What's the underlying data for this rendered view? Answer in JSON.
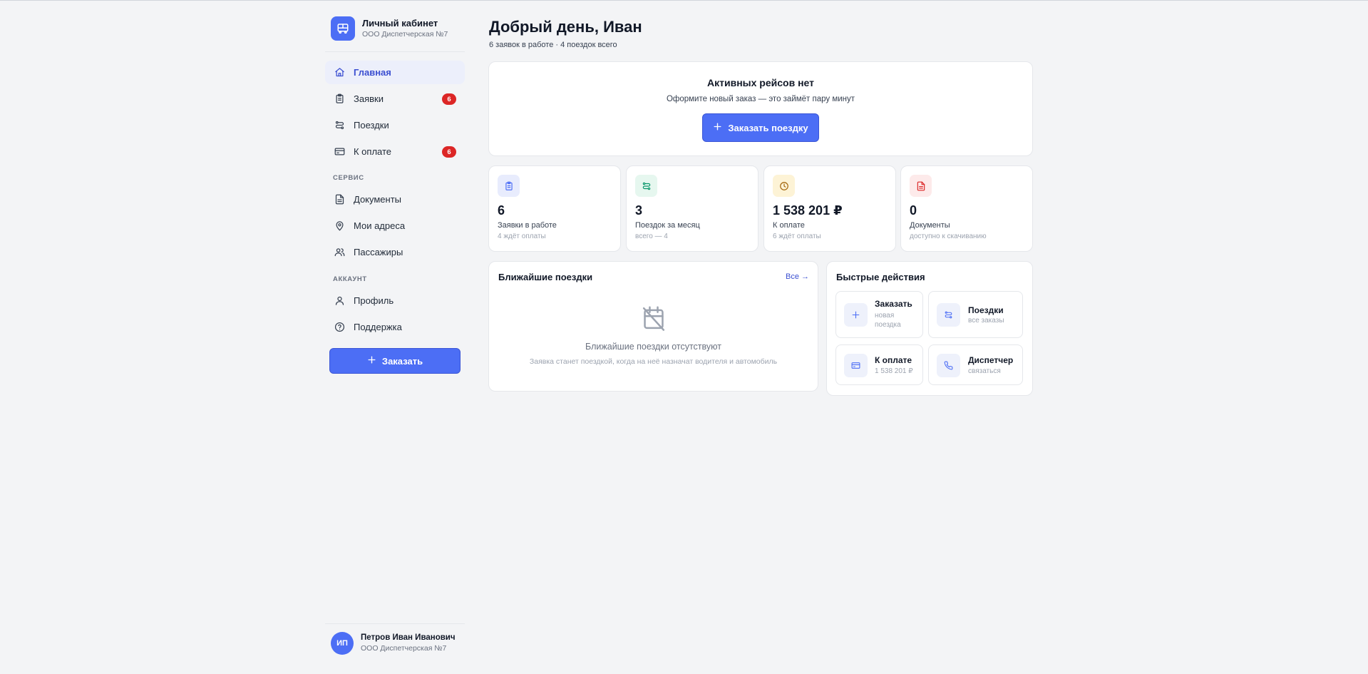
{
  "brand": {
    "title": "Личный кабинет",
    "subtitle": "ООО Диспетчерская №7",
    "icon": "bus-icon",
    "accent": "#4c6ef5"
  },
  "sidebar": {
    "items": [
      {
        "label": "Главная",
        "icon": "home-icon",
        "active": true
      },
      {
        "label": "Заявки",
        "icon": "clipboard-icon",
        "badge": "6"
      },
      {
        "label": "Поездки",
        "icon": "route-icon"
      },
      {
        "label": "К оплате",
        "icon": "credit-card-icon",
        "badge": "6"
      }
    ],
    "section_service": "СЕРВИС",
    "service_items": [
      {
        "label": "Документы",
        "icon": "document-icon"
      },
      {
        "label": "Мои адреса",
        "icon": "map-pin-icon"
      },
      {
        "label": "Пассажиры",
        "icon": "users-icon"
      }
    ],
    "section_account": "АККАУНТ",
    "account_items": [
      {
        "label": "Профиль",
        "icon": "user-icon"
      },
      {
        "label": "Поддержка",
        "icon": "help-circle-icon"
      }
    ],
    "order_button": "Заказать",
    "badge_color": "#dc2626"
  },
  "user": {
    "initials": "ИП",
    "name": "Петров Иван Иванович",
    "org": "ООО Диспетчерская №7"
  },
  "header": {
    "greeting": "Добрый день, Иван",
    "summary": "6 заявок в работе · 4 поездок всего"
  },
  "hero": {
    "title": "Активных рейсов нет",
    "subtitle": "Оформите новый заказ — это займёт пару минут",
    "button": "Заказать поездку"
  },
  "stats": [
    {
      "value": "6",
      "label": "Заявки в работе",
      "hint": "4 ждёт оплаты",
      "icon": "clipboard-icon",
      "color": "#4c6ef5"
    },
    {
      "value": "3",
      "label": "Поездок за месяц",
      "hint": "всего — 4",
      "icon": "route-icon",
      "color": "#059669"
    },
    {
      "value": "1 538 201 ₽",
      "label": "К оплате",
      "hint": "6 ждёт оплаты",
      "icon": "clock-icon",
      "color": "#a16207"
    },
    {
      "value": "0",
      "label": "Документы",
      "hint": "доступно к скачиванию",
      "icon": "document-icon",
      "color": "#dc2626"
    }
  ],
  "trips": {
    "title": "Ближайшие поездки",
    "all_link": "Все →",
    "empty_title": "Ближайшие поездки отсутствуют",
    "empty_subtitle": "Заявка станет поездкой, когда на неё назначат водителя и автомобиль",
    "empty_icon": "calendar-off-icon"
  },
  "quick": {
    "title": "Быстрые действия",
    "actions": [
      {
        "title": "Заказать",
        "sub": "новая поездка",
        "icon": "plus-icon"
      },
      {
        "title": "Поездки",
        "sub": "все заказы",
        "icon": "route-icon"
      },
      {
        "title": "К оплате",
        "sub": "1 538 201 ₽",
        "icon": "credit-card-icon"
      },
      {
        "title": "Диспетчер",
        "sub": "связаться",
        "icon": "phone-icon"
      }
    ]
  }
}
